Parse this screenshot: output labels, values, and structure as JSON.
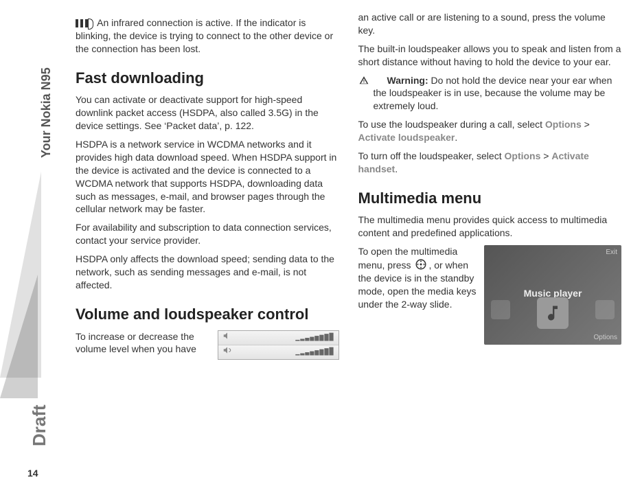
{
  "side": {
    "chapter": "Your Nokia N95",
    "draft": "Draft",
    "page_number": "14"
  },
  "left": {
    "infrared_para": " An infrared connection is active. If the indicator is blinking, the device is trying to connect to the other device or the connection has been lost.",
    "h_fast": "Fast downloading",
    "fast_p1": "You can activate or deactivate support for high-speed downlink packet access (HSDPA, also called 3.5G) in the device settings. See ‘Packet data’, p. 122.",
    "fast_p2": "HSDPA is a network service in WCDMA networks and it provides high data download speed. When HSDPA support in the device is activated and the device is connected to a WCDMA network that supports HSDPA, downloading data such as messages, e-mail, and browser pages through the cellular network may be faster.",
    "fast_p3": "For availability and subscription to data connection services, contact your service provider.",
    "fast_p4": "HSDPA only affects the download speed; sending data to the network, such as sending messages and e-mail, is not affected.",
    "h_volume": "Volume and loudspeaker control",
    "vol_p1": "To increase or decrease the volume level when you have "
  },
  "right": {
    "cont_p": "an active call or are listening to a sound, press the volume key.",
    "ls_p1": "The built-in loudspeaker allows you to speak and listen from a short distance without having to hold the device to your ear.",
    "warning_label": "Warning:",
    "warning_body": " Do not hold the device near your ear when the loudspeaker is in use, because the volume may be extremely loud.",
    "ls_use_pre": "To use the loudspeaker during a call, select ",
    "options": "Options",
    "gt": " > ",
    "activate_ls": "Activate loudspeaker",
    "ls_off_pre": "To turn off the loudspeaker, select ",
    "activate_hs": "Activate handset",
    "period": ".",
    "h_mm": "Multimedia menu",
    "mm_p1": "The multimedia menu provides quick access to multimedia content and predefined applications.",
    "mm_p2_a": "To open the multimedia menu, press ",
    "mm_p2_b": ", or when the device is in the standby mode, open the media keys under the 2-way slide.",
    "mm_img": {
      "exit": "Exit",
      "title": "Music player",
      "options": "Options"
    }
  }
}
